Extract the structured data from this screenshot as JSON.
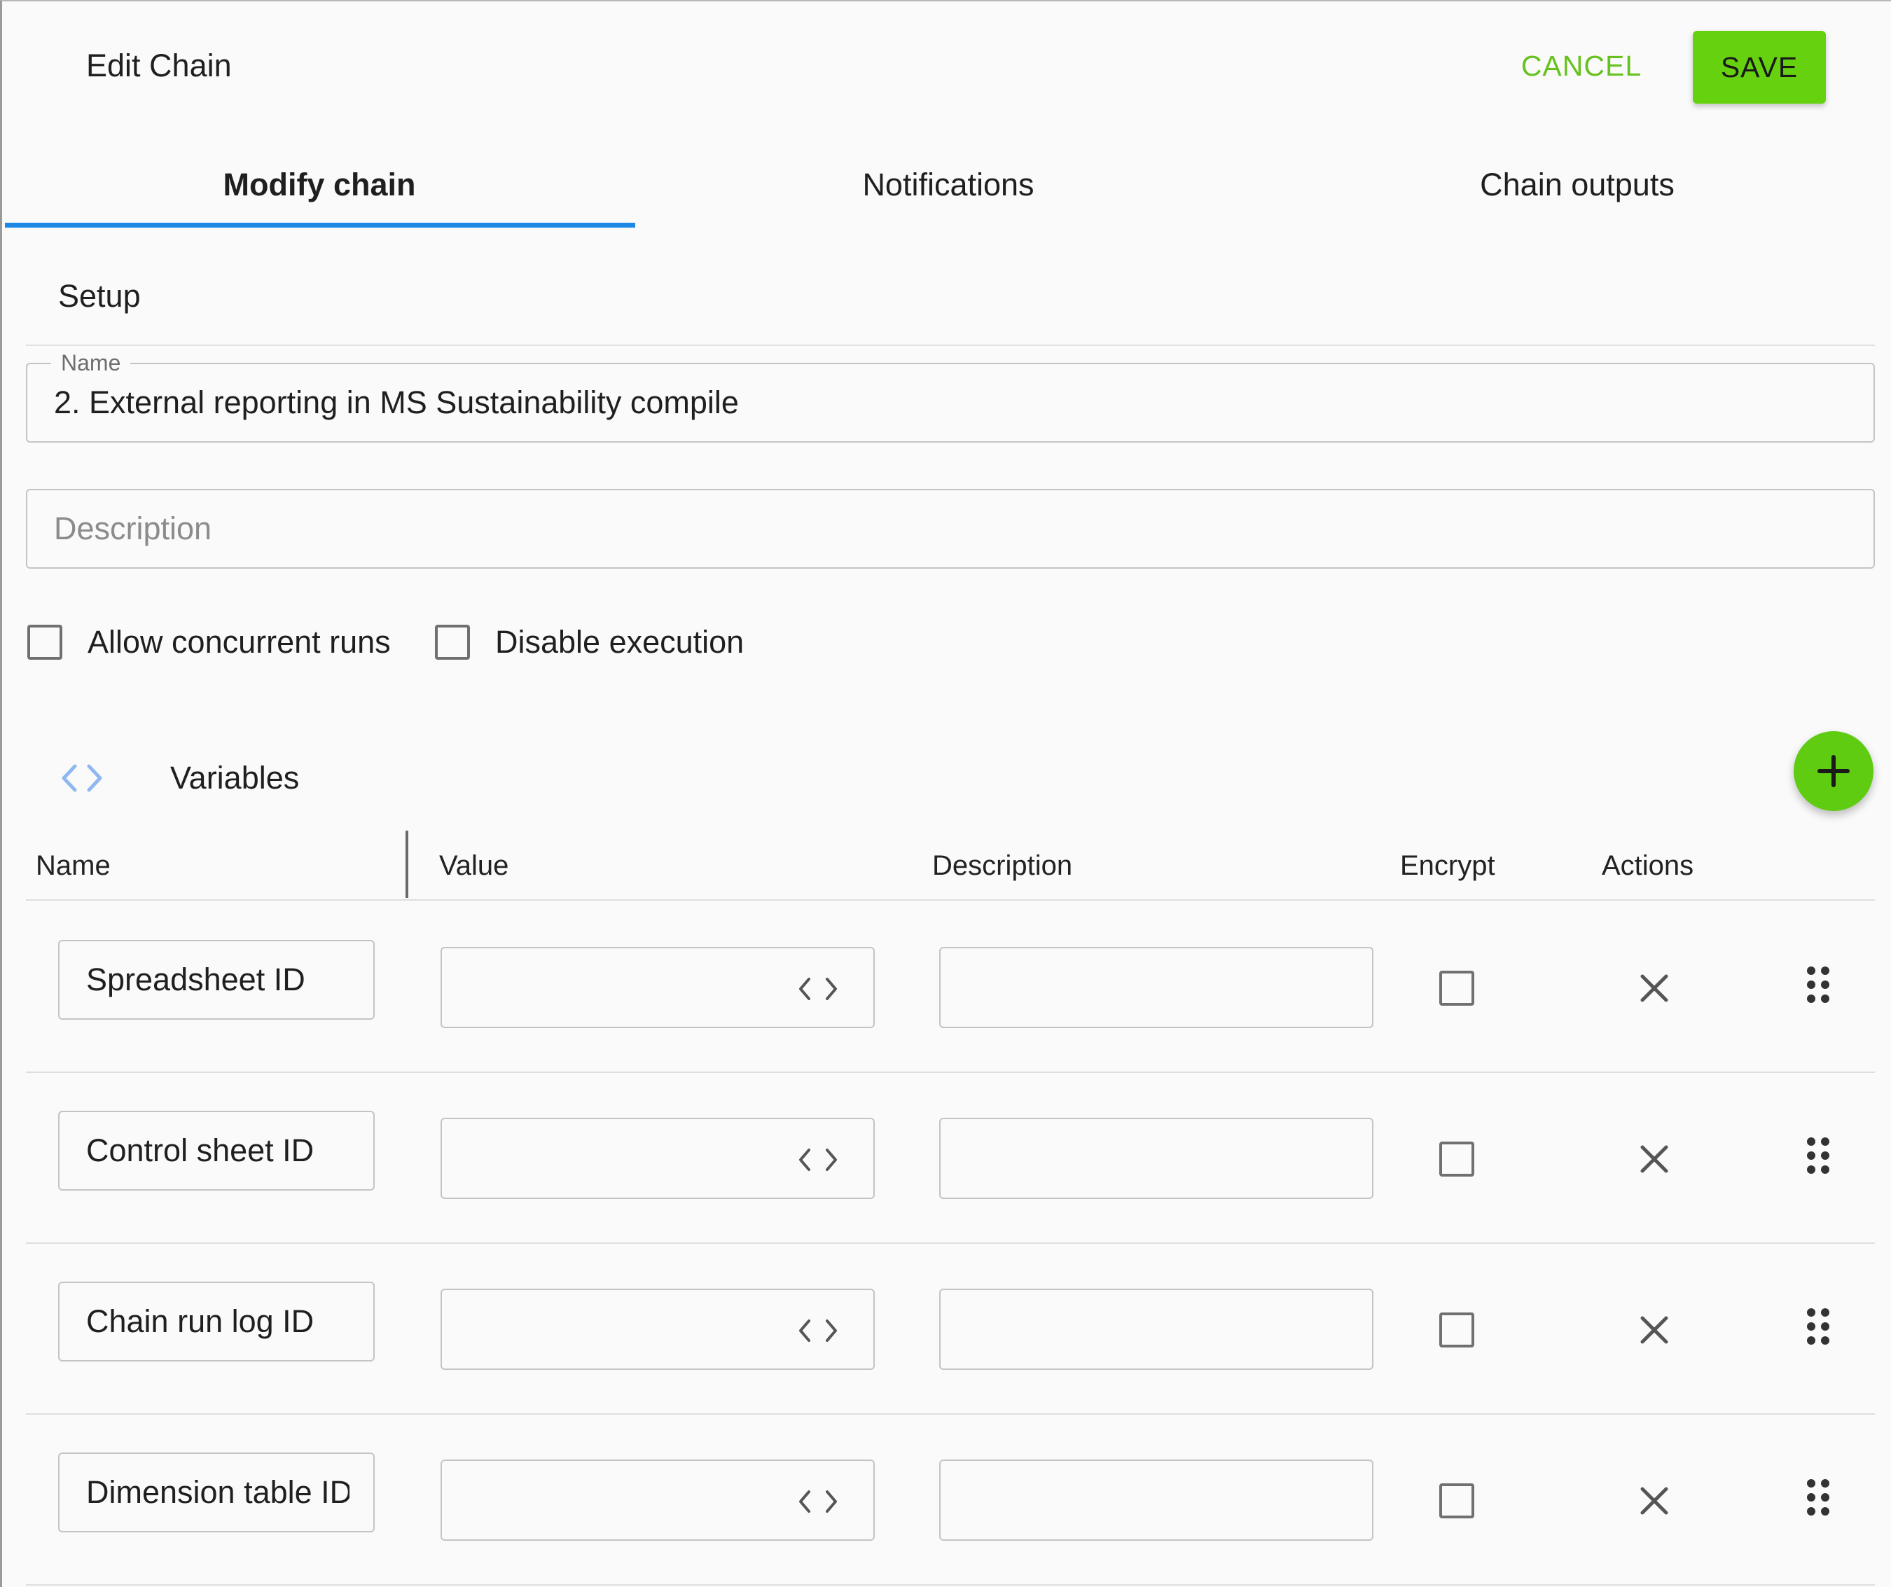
{
  "dialog": {
    "title": "Edit Chain",
    "cancel_label": "CANCEL",
    "save_label": "SAVE"
  },
  "colors": {
    "accent_green": "#66d20f",
    "cancel_green": "#66c21e",
    "tab_indicator_blue": "#1e88e5",
    "code_icon_blue": "#90b8f0"
  },
  "tabs": [
    {
      "label": "Modify chain",
      "active": true
    },
    {
      "label": "Notifications",
      "active": false
    },
    {
      "label": "Chain outputs",
      "active": false
    }
  ],
  "setup": {
    "title": "Setup",
    "name_field": {
      "label": "Name",
      "value": "2. External reporting in MS Sustainability compile"
    },
    "description_field": {
      "placeholder": "Description",
      "value": ""
    },
    "checkboxes": [
      {
        "label": "Allow concurrent runs",
        "checked": false
      },
      {
        "label": "Disable execution",
        "checked": false
      }
    ]
  },
  "variables": {
    "title": "Variables",
    "title_icon": "code-brackets-icon",
    "add_icon": "plus-icon",
    "columns": [
      "Name",
      "Value",
      "Description",
      "Encrypt",
      "Actions"
    ],
    "rows": [
      {
        "name": "Spreadsheet ID",
        "value": "",
        "description": "",
        "encrypt": false
      },
      {
        "name": "Control sheet ID",
        "value": "",
        "description": "",
        "encrypt": false
      },
      {
        "name": "Chain run log ID",
        "value": "",
        "description": "",
        "encrypt": false
      },
      {
        "name": "Dimension table ID",
        "value": "",
        "description": "",
        "encrypt": false
      }
    ],
    "row_icons": {
      "value_icon": "code-brackets-icon",
      "delete_icon": "close-icon",
      "drag_icon": "drag-handle-icon"
    }
  }
}
